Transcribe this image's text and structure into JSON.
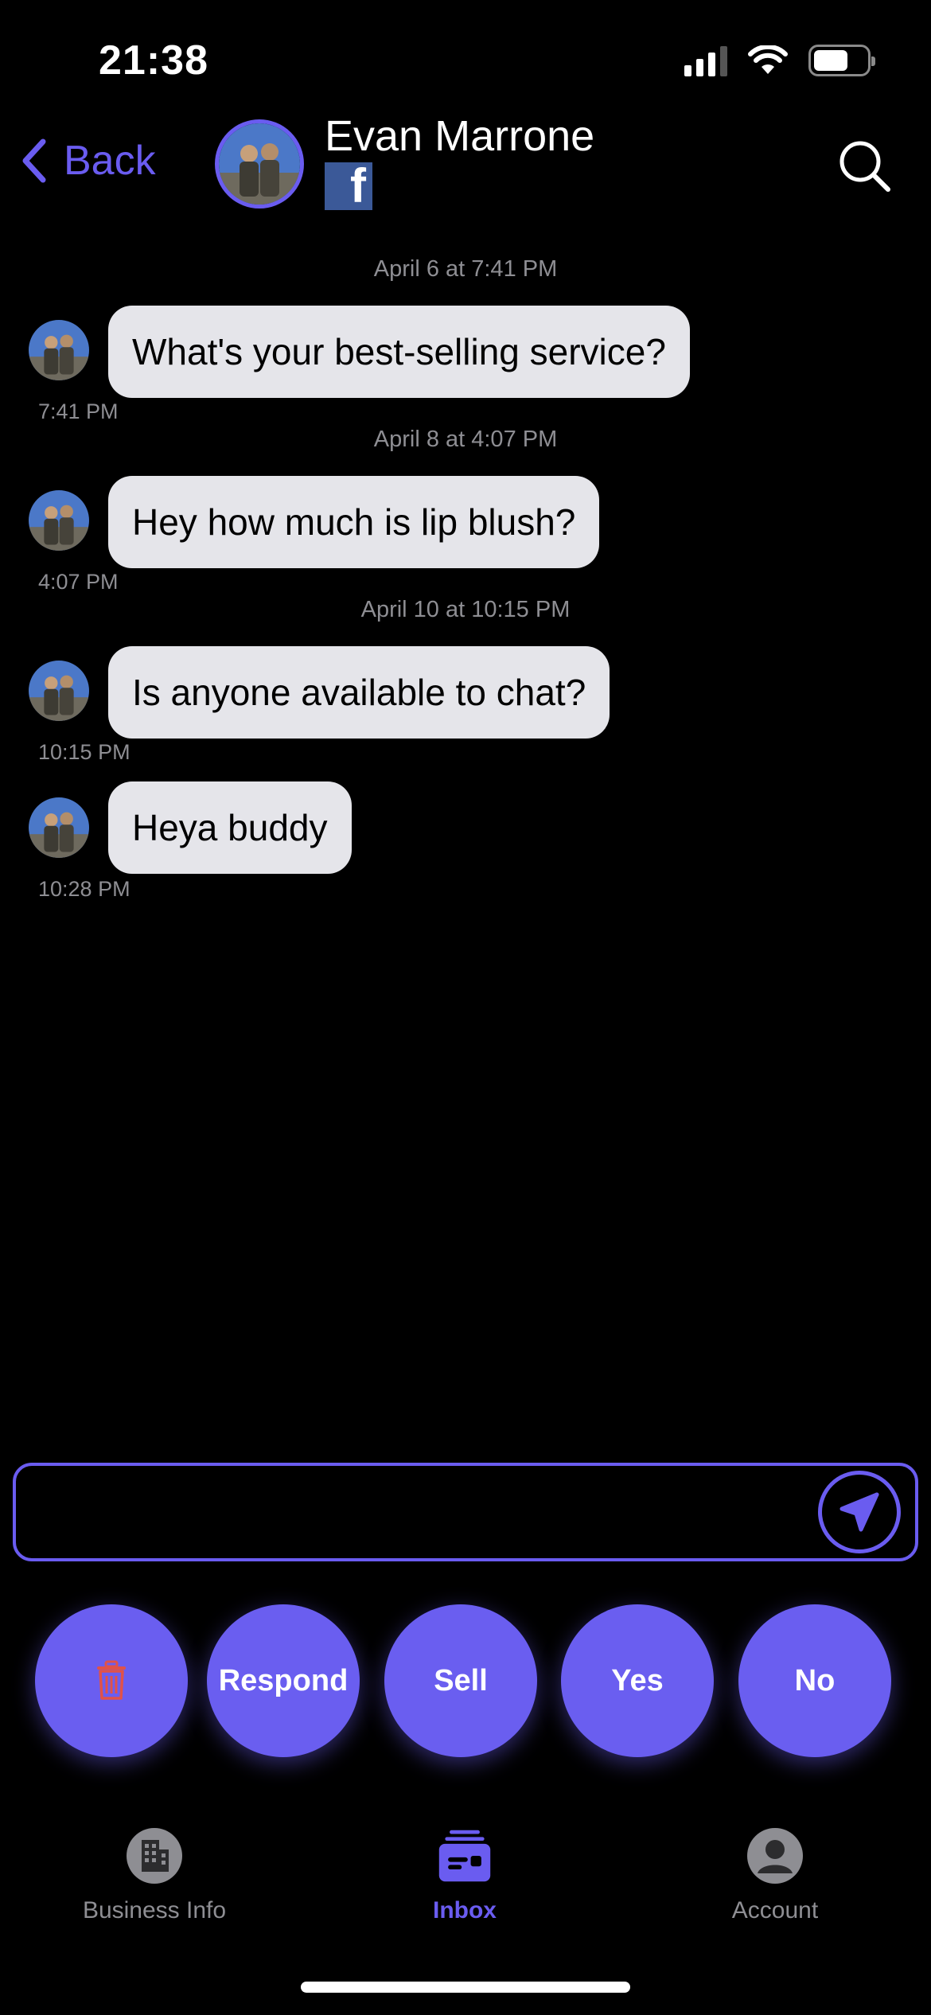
{
  "status_bar": {
    "time": "21:38"
  },
  "header": {
    "back_label": "Back",
    "contact_name": "Evan Marrone",
    "source_badge": "f"
  },
  "messages": [
    {
      "date_header": "April 6 at 7:41 PM",
      "text": "What's your best-selling service?",
      "time": "7:41 PM"
    },
    {
      "date_header": "April 8 at 4:07 PM",
      "text": "Hey how much is lip blush?",
      "time": "4:07 PM"
    },
    {
      "date_header": "April 10 at 10:15 PM",
      "text": "Is anyone available to chat?",
      "time": "10:15 PM"
    },
    {
      "date_header": "",
      "text": "Heya buddy",
      "time": "10:28 PM"
    }
  ],
  "composer": {
    "value": "",
    "placeholder": ""
  },
  "quick_replies": [
    "Respond",
    "Sell",
    "Yes",
    "No"
  ],
  "tabs": [
    {
      "label": "Business Info",
      "active": false
    },
    {
      "label": "Inbox",
      "active": true
    },
    {
      "label": "Account",
      "active": false
    }
  ],
  "colors": {
    "accent": "#6a5cf0",
    "bubble": "#e5e5ea",
    "muted_text": "#8e8e93",
    "delete_icon": "#e0524a"
  }
}
